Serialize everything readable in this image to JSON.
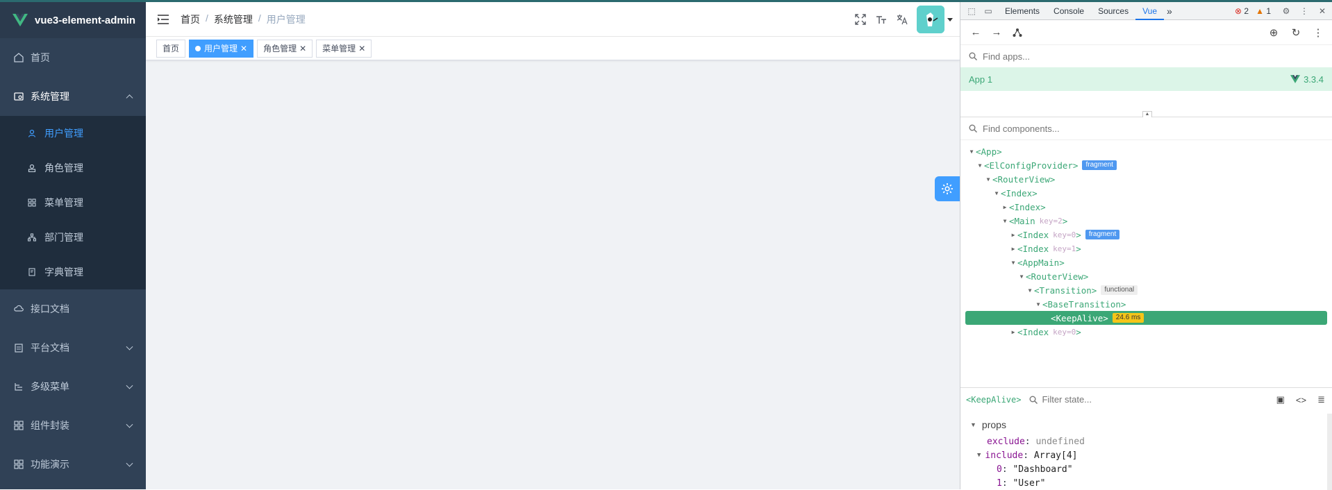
{
  "sidebar": {
    "logo_text": "vue3-element-admin",
    "items": [
      {
        "label": "首页",
        "icon": "home-icon"
      },
      {
        "label": "系统管理",
        "icon": "system-icon",
        "expanded": true
      },
      {
        "label": "接口文档",
        "icon": "api-doc-icon"
      },
      {
        "label": "平台文档",
        "icon": "platform-doc-icon"
      },
      {
        "label": "多级菜单",
        "icon": "multi-level-menu-icon"
      },
      {
        "label": "组件封装",
        "icon": "component-icon"
      },
      {
        "label": "功能演示",
        "icon": "demo-icon"
      }
    ],
    "submenu": [
      {
        "label": "用户管理",
        "icon": "user-icon",
        "active": true
      },
      {
        "label": "角色管理",
        "icon": "role-icon"
      },
      {
        "label": "菜单管理",
        "icon": "menu-icon"
      },
      {
        "label": "部门管理",
        "icon": "department-icon"
      },
      {
        "label": "字典管理",
        "icon": "dictionary-icon"
      }
    ]
  },
  "navbar": {
    "breadcrumb": [
      "首页",
      "系统管理",
      "用户管理"
    ],
    "separator": "/"
  },
  "tags": [
    {
      "label": "首页",
      "active": false
    },
    {
      "label": "用户管理",
      "active": true
    },
    {
      "label": "角色管理",
      "active": false
    },
    {
      "label": "菜单管理",
      "active": false
    }
  ],
  "tag_close": "✕",
  "devtools": {
    "tabs": [
      "Elements",
      "Console",
      "Sources",
      "Vue"
    ],
    "active_tab": "Vue",
    "more": "»",
    "error_count": "2",
    "warning_count": "1",
    "find_apps_placeholder": "Find apps...",
    "app_name": "App 1",
    "vue_version": "3.3.4",
    "find_components_placeholder": "Find components...",
    "tree": [
      {
        "label": "<App>",
        "depth": 0,
        "tri": "▼"
      },
      {
        "label": "<ElConfigProvider>",
        "depth": 1,
        "tri": "▼",
        "badge": "fragment",
        "badge_type": "frag"
      },
      {
        "label": "<RouterView>",
        "depth": 2,
        "tri": "▼"
      },
      {
        "label": "<Index>",
        "depth": 3,
        "tri": "▼"
      },
      {
        "label": "<Index>",
        "depth": 4,
        "tri": "▶"
      },
      {
        "label": "<Main",
        "depth": 4,
        "tri": "▼",
        "attr": "key=2",
        "close": ">"
      },
      {
        "label": "<Index",
        "depth": 5,
        "tri": "▶",
        "attr": "key=0",
        "close": ">",
        "badge": "fragment",
        "badge_type": "frag"
      },
      {
        "label": "<Index",
        "depth": 5,
        "tri": "▶",
        "attr": "key=1",
        "close": ">"
      },
      {
        "label": "<AppMain>",
        "depth": 5,
        "tri": "▼"
      },
      {
        "label": "<RouterView>",
        "depth": 6,
        "tri": "▼"
      },
      {
        "label": "<Transition>",
        "depth": 7,
        "tri": "▼",
        "badge": "functional",
        "badge_type": "func"
      },
      {
        "label": "<BaseTransition>",
        "depth": 8,
        "tri": "▼"
      },
      {
        "label": "<KeepAlive>",
        "depth": 9,
        "tri": "",
        "badge": "24.6 ms",
        "badge_type": "time",
        "selected": true
      },
      {
        "label": "<Index",
        "depth": 5,
        "tri": "▶",
        "attr": "key=0",
        "close": ">"
      }
    ],
    "state_component": "<KeepAlive>",
    "filter_state_placeholder": "Filter state...",
    "state": {
      "section": "props",
      "rows": [
        {
          "key": "exclude",
          "value": "undefined",
          "type": "undef"
        },
        {
          "key": "include",
          "value": "Array[4]",
          "type": "array"
        },
        {
          "key": "0",
          "value": "\"Dashboard\"",
          "type": "item"
        },
        {
          "key": "1",
          "value": "\"User\"",
          "type": "item"
        }
      ]
    }
  },
  "colors": {
    "sidebar_bg": "#304156",
    "accent": "#409eff",
    "vue_green": "#3ba776"
  }
}
